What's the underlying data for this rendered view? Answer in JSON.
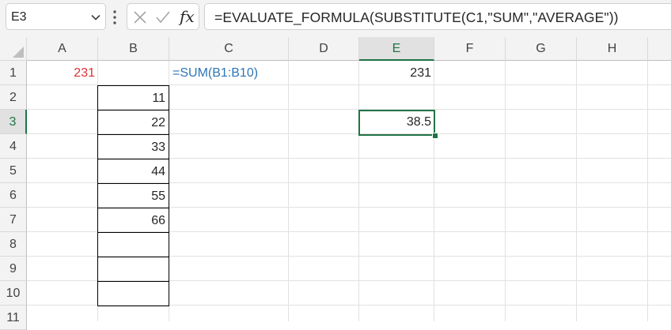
{
  "name_box": {
    "value": "E3"
  },
  "formula_bar": {
    "fx_label": "fx",
    "formula": "=EVALUATE_FORMULA(SUBSTITUTE(C1,\"SUM\",\"AVERAGE\"))"
  },
  "columns": [
    "A",
    "B",
    "C",
    "D",
    "E",
    "F",
    "G",
    "H"
  ],
  "rows": [
    "1",
    "2",
    "3",
    "4",
    "5",
    "6",
    "7",
    "8",
    "9",
    "10",
    "11"
  ],
  "selected": {
    "column": "E",
    "row": "3"
  },
  "cells": {
    "A1": "231",
    "C1": "=SUM(B1:B10)",
    "E1": "231",
    "B2": "11",
    "B3": "22",
    "B4": "33",
    "B5": "44",
    "B6": "55",
    "B7": "66",
    "E3": "38.5"
  },
  "colors": {
    "A1_text": "#e03030",
    "C1_text": "#2e75b6",
    "selection_accent": "#217346"
  }
}
